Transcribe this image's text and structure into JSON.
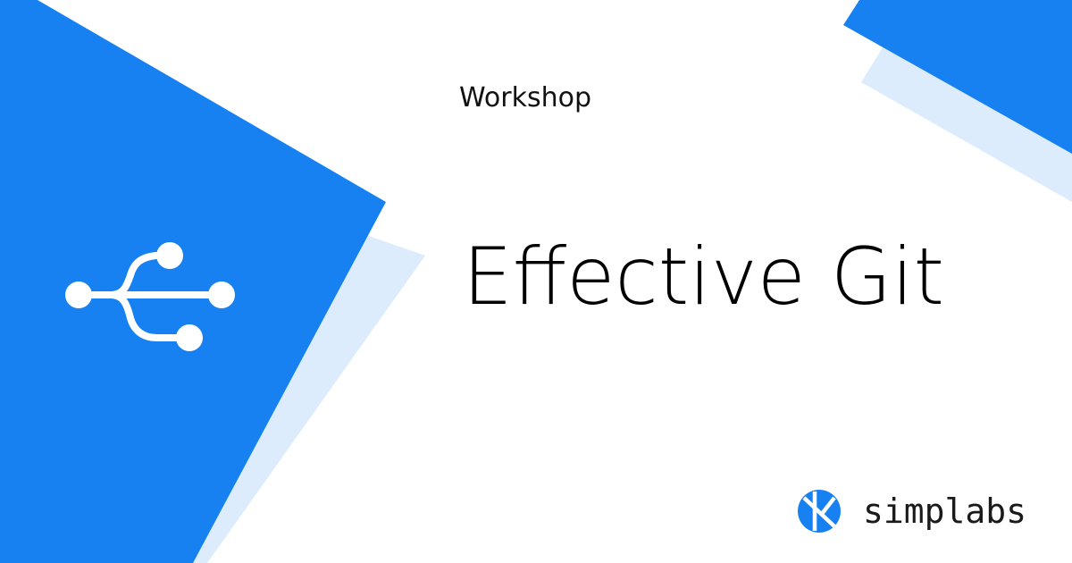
{
  "eyebrow": "Workshop",
  "title": "Effective Git",
  "brand": {
    "name": "simplabs"
  },
  "icons": {
    "hero": "git-branch-icon",
    "brand": "simplabs-logo-icon"
  },
  "colors": {
    "primary_blue": "#1781f2",
    "light_blue": "#dcecfc",
    "background": "#ffffff",
    "text": "#000000"
  }
}
